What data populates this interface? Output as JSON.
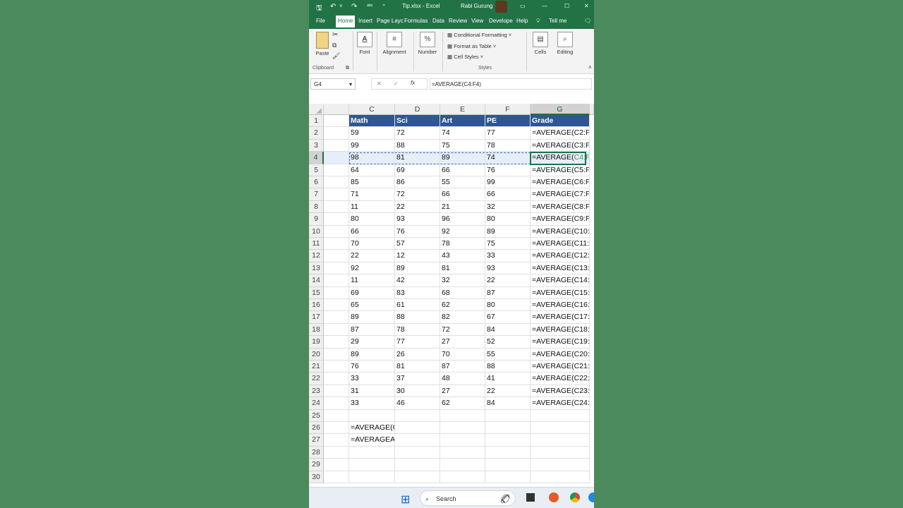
{
  "titlebar": {
    "filename": "Tip.xlsx - Excel",
    "user": "Rabi Gurung",
    "save_icon": "save-icon",
    "undo_icon": "undo-icon",
    "redo_icon": "redo-icon",
    "spell_icon": "spellcheck-icon",
    "min": "—",
    "max": "☐",
    "close": "✕",
    "ribbon_opts": "▭"
  },
  "tabs": [
    "File",
    "Home",
    "Insert",
    "Page Layc",
    "Formulas",
    "Data",
    "Review",
    "View",
    "Develope",
    "Help",
    "Tell me"
  ],
  "ribbon": {
    "paste": "Paste",
    "clipboard": "Clipboard",
    "font": "Font",
    "alignment": "Alignment",
    "number": "Number",
    "conditional": "Conditional Formatting ˅",
    "format_table": "Format as Table ˅",
    "cell_styles": "Cell Styles ˅",
    "styles": "Styles",
    "cells": "Cells",
    "editing": "Editing"
  },
  "formula_bar": {
    "name_box": "G4",
    "formula": "=AVERAGE(C4:F4)"
  },
  "columns": [
    "C",
    "D",
    "E",
    "F",
    "G"
  ],
  "headers": [
    "Math",
    "Sci",
    "Art",
    "PE",
    "Grade"
  ],
  "rows": [
    {
      "n": "2",
      "c": "59",
      "d": "72",
      "e": "74",
      "f": "77",
      "g": "=AVERAGE(C2:F2"
    },
    {
      "n": "3",
      "c": "99",
      "d": "88",
      "e": "75",
      "f": "78",
      "g": "=AVERAGE(C3:F3"
    },
    {
      "n": "4",
      "c": "98",
      "d": "81",
      "e": "89",
      "f": "74",
      "g": "=AVERAGE(",
      "gref": "C4:F4"
    },
    {
      "n": "5",
      "c": "64",
      "d": "69",
      "e": "66",
      "f": "76",
      "g": "=AVERAGE(C5:F5"
    },
    {
      "n": "6",
      "c": "85",
      "d": "86",
      "e": "55",
      "f": "99",
      "g": "=AVERAGE(C6:F6"
    },
    {
      "n": "7",
      "c": "71",
      "d": "72",
      "e": "66",
      "f": "66",
      "g": "=AVERAGE(C7:F7"
    },
    {
      "n": "8",
      "c": "11",
      "d": "22",
      "e": "21",
      "f": "32",
      "g": "=AVERAGE(C8:F8"
    },
    {
      "n": "9",
      "c": "80",
      "d": "93",
      "e": "96",
      "f": "80",
      "g": "=AVERAGE(C9:F9"
    },
    {
      "n": "10",
      "c": "66",
      "d": "76",
      "e": "92",
      "f": "89",
      "g": "=AVERAGE(C10:F"
    },
    {
      "n": "11",
      "c": "70",
      "d": "57",
      "e": "78",
      "f": "75",
      "g": "=AVERAGE(C11:F"
    },
    {
      "n": "12",
      "c": "22",
      "d": "12",
      "e": "43",
      "f": "33",
      "g": "=AVERAGE(C12:F"
    },
    {
      "n": "13",
      "c": "92",
      "d": "89",
      "e": "81",
      "f": "93",
      "g": "=AVERAGE(C13:F"
    },
    {
      "n": "14",
      "c": "11",
      "d": "42",
      "e": "32",
      "f": "22",
      "g": "=AVERAGE(C14:F"
    },
    {
      "n": "15",
      "c": "69",
      "d": "83",
      "e": "68",
      "f": "87",
      "g": "=AVERAGE(C15:F"
    },
    {
      "n": "16",
      "c": "65",
      "d": "61",
      "e": "62",
      "f": "80",
      "g": "=AVERAGE(C16:F"
    },
    {
      "n": "17",
      "c": "89",
      "d": "88",
      "e": "82",
      "f": "67",
      "g": "=AVERAGE(C17:F"
    },
    {
      "n": "18",
      "c": "87",
      "d": "78",
      "e": "72",
      "f": "84",
      "g": "=AVERAGE(C18:F"
    },
    {
      "n": "19",
      "c": "29",
      "d": "77",
      "e": "27",
      "f": "52",
      "g": "=AVERAGE(C19:F"
    },
    {
      "n": "20",
      "c": "89",
      "d": "26",
      "e": "70",
      "f": "55",
      "g": "=AVERAGE(C20:F"
    },
    {
      "n": "21",
      "c": "76",
      "d": "81",
      "e": "87",
      "f": "88",
      "g": "=AVERAGE(C21:F"
    },
    {
      "n": "22",
      "c": "33",
      "d": "37",
      "e": "48",
      "f": "41",
      "g": "=AVERAGE(C22:F"
    },
    {
      "n": "23",
      "c": "31",
      "d": "30",
      "e": "27",
      "f": "22",
      "g": "=AVERAGE(C23:F"
    },
    {
      "n": "24",
      "c": "33",
      "d": "46",
      "e": "62",
      "f": "84",
      "g": "=AVERAGE(C24:F"
    },
    {
      "n": "25",
      "c": "",
      "d": "",
      "e": "",
      "f": "",
      "g": ""
    },
    {
      "n": "26",
      "c": "=AVERAGE(C",
      "d": "",
      "e": "",
      "f": "",
      "g": ""
    },
    {
      "n": "27",
      "c": "=AVERAGEA",
      "d": "",
      "e": "",
      "f": "",
      "g": ""
    },
    {
      "n": "28",
      "c": "",
      "d": "",
      "e": "",
      "f": "",
      "g": ""
    },
    {
      "n": "29",
      "c": "",
      "d": "",
      "e": "",
      "f": "",
      "g": ""
    },
    {
      "n": "30",
      "c": "",
      "d": "",
      "e": "",
      "f": "",
      "g": ""
    }
  ],
  "taskbar": {
    "search_placeholder": "Search"
  },
  "colors": {
    "excel_green": "#217346",
    "header_blue": "#2f5597",
    "highlight_row": "#e6eef8"
  }
}
